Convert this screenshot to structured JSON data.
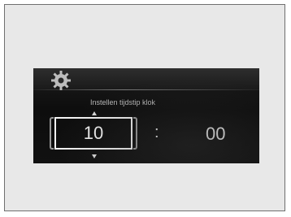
{
  "settings_screen": {
    "header_icon": "gear-icon",
    "title": "Instellen tijdstip klok",
    "hour": "10",
    "separator": ":",
    "minutes": "00"
  }
}
